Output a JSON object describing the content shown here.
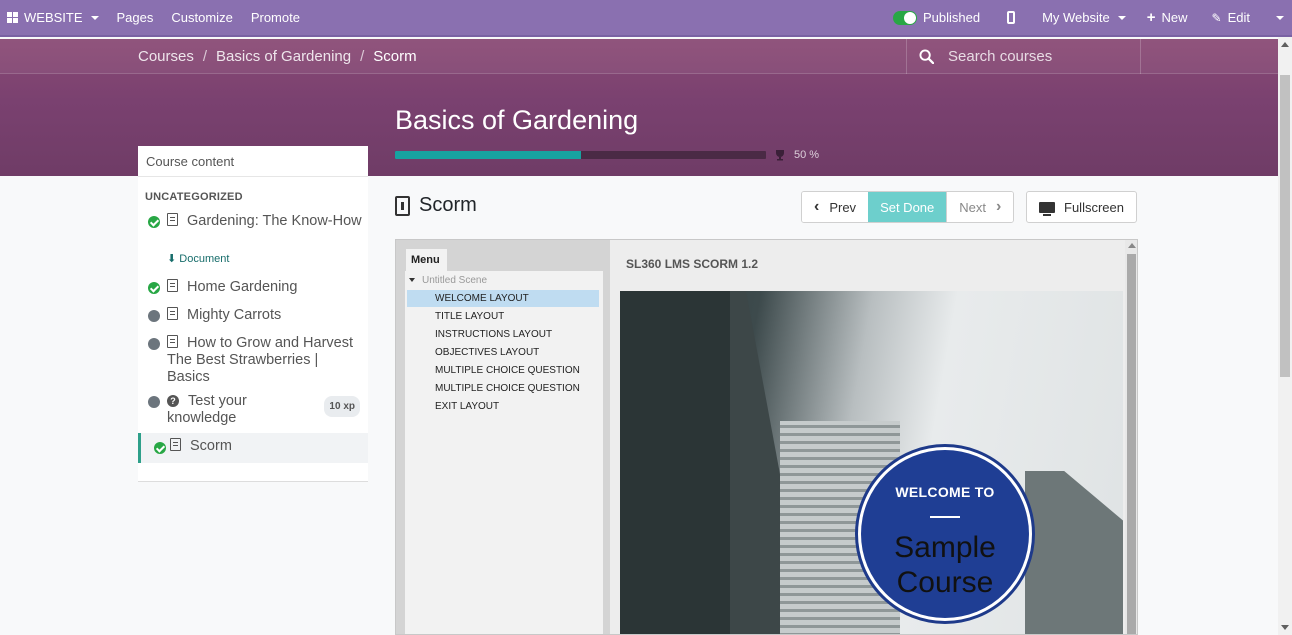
{
  "topbar": {
    "brand": "WEBSITE",
    "pages": "Pages",
    "customize": "Customize",
    "promote": "Promote",
    "published": "Published",
    "website_select": "My Website",
    "new": "New",
    "edit": "Edit"
  },
  "breadcrumb": {
    "courses": "Courses",
    "sep": "/",
    "course": "Basics of Gardening",
    "current": "Scorm"
  },
  "search": {
    "placeholder": "Search courses"
  },
  "course": {
    "title": "Basics of Gardening",
    "progress_percent": 50,
    "progress_text": "50 %"
  },
  "sidebar": {
    "header": "Course content",
    "category": "UNCATEGORIZED",
    "slides": [
      {
        "label": "Gardening: The Know-How",
        "completed": true,
        "icon": "file-pdf-icon",
        "sub_link": "Document"
      },
      {
        "label": "Home Gardening",
        "completed": true,
        "icon": "file-image-icon"
      },
      {
        "label": "Mighty Carrots",
        "completed": false,
        "icon": "file-image-icon"
      },
      {
        "label": "How to Grow and Harvest The Best Strawberries | Basics",
        "completed": false,
        "icon": "file-pdf-icon"
      },
      {
        "label": "Test your knowledge",
        "completed": false,
        "icon": "question-circle-icon",
        "badge": "10 xp"
      },
      {
        "label": "Scorm",
        "completed": true,
        "icon": "file-archive-icon",
        "active": true
      }
    ]
  },
  "main": {
    "title": "Scorm",
    "prev": "Prev",
    "set_done": "Set Done",
    "next": "Next",
    "fullscreen": "Fullscreen"
  },
  "player": {
    "menu_tab": "Menu",
    "scene": "Untitled Scene",
    "items": [
      "WELCOME LAYOUT",
      "TITLE LAYOUT",
      "INSTRUCTIONS LAYOUT",
      "OBJECTIVES LAYOUT",
      "MULTIPLE CHOICE QUESTION",
      "MULTIPLE CHOICE QUESTION",
      "EXIT LAYOUT"
    ],
    "selected_index": 0,
    "content_title": "SL360 LMS SCORM 1.2",
    "badge_welcome": "WELCOME TO",
    "badge_sample": "Sample",
    "badge_course": "Course"
  },
  "colors": {
    "topbar": "#8a70b0",
    "header": "#7a4170",
    "progress": "#17a2a0",
    "set_done": "#6dcfcc",
    "check": "#28a745"
  }
}
